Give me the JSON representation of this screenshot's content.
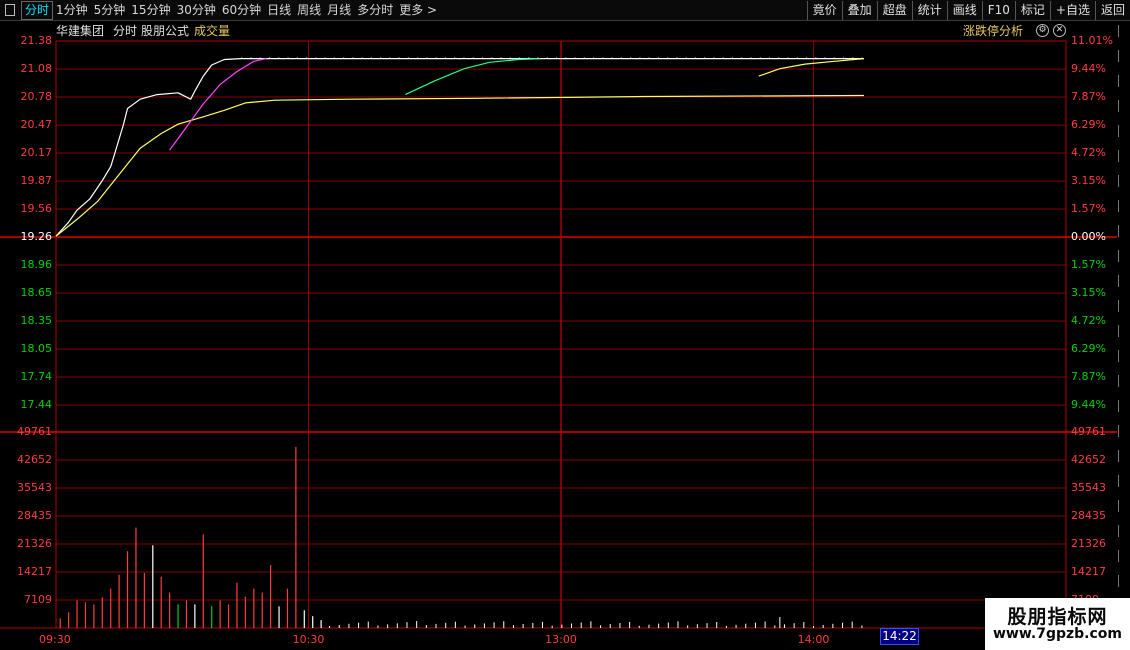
{
  "toolbar": {
    "tabs": [
      "分时",
      "1分钟",
      "5分钟",
      "15分钟",
      "30分钟",
      "60分钟",
      "日线",
      "周线",
      "月线",
      "多分时",
      "更多 >"
    ],
    "active_tab": "分时",
    "right_buttons": [
      "竟价",
      "叠加",
      "超盘",
      "统计",
      "画线",
      "F10",
      "标记",
      "+自选",
      "返回"
    ]
  },
  "header": {
    "stock_name": "华建集团",
    "mode": "分时",
    "formula": "股朋公式",
    "indicator": "成交量",
    "analysis_label": "涨跌停分析",
    "gear_icon": "gear-icon",
    "close_icon": "close-icon"
  },
  "price_axis": {
    "left_up": [
      "21.38",
      "21.08",
      "20.78",
      "20.47",
      "20.17",
      "19.87",
      "19.56"
    ],
    "base": "19.26",
    "left_down": [
      "18.96",
      "18.65",
      "18.35",
      "18.05",
      "17.74",
      "17.44"
    ],
    "right_up": [
      "11.01%",
      "9.44%",
      "7.87%",
      "6.29%",
      "4.72%",
      "3.15%",
      "1.57%"
    ],
    "base_pct": "0.00%",
    "right_down": [
      "1.57%",
      "3.15%",
      "4.72%",
      "6.29%",
      "7.87%",
      "9.44%"
    ]
  },
  "volume_axis": {
    "labels": [
      "49761",
      "42652",
      "35543",
      "28435",
      "21326",
      "14217",
      "7109"
    ]
  },
  "time_axis": {
    "labels": [
      "09:30",
      "10:30",
      "13:00",
      "14:00"
    ],
    "current_time": "14:22"
  },
  "watermark": {
    "title": "股朋指标网",
    "url": "www.7gpzb.com"
  },
  "colors": {
    "background": "#000000",
    "grid_red": "#b40000",
    "up_red": "#ff3c3c",
    "down_green": "#00d200",
    "price_line": "#ffffff",
    "avg_line": "#ffff60",
    "magenta_line": "#ff44ff",
    "green_line": "#20ff80",
    "header_yellow": "#e8c860",
    "accent_cyan": "#00e0ff"
  },
  "chart_data": {
    "type": "line",
    "base_price": 19.26,
    "price_ylim": [
      17.14,
      21.38
    ],
    "session_minutes": 240,
    "series": [
      {
        "values_by_minute": [
          [
            0,
            19.27
          ],
          [
            3,
            19.42
          ],
          [
            5,
            19.55
          ],
          [
            8,
            19.67
          ],
          [
            11,
            19.87
          ],
          [
            13,
            20.02
          ],
          [
            14,
            20.17
          ],
          [
            16,
            20.47
          ],
          [
            17,
            20.65
          ],
          [
            20,
            20.75
          ],
          [
            24,
            20.8
          ],
          [
            29,
            20.82
          ],
          [
            32,
            20.75
          ],
          [
            33,
            20.84
          ],
          [
            35,
            21.0
          ],
          [
            37,
            21.12
          ],
          [
            40,
            21.18
          ],
          [
            44,
            21.19
          ],
          [
            52,
            21.19
          ],
          [
            60,
            21.19
          ],
          [
            100,
            21.19
          ],
          [
            160,
            21.19
          ],
          [
            192,
            21.19
          ]
        ]
      },
      {
        "values_by_minute": [
          [
            0,
            19.27
          ],
          [
            5,
            19.45
          ],
          [
            10,
            19.65
          ],
          [
            14,
            19.88
          ],
          [
            17,
            20.05
          ],
          [
            20,
            20.22
          ],
          [
            25,
            20.38
          ],
          [
            29,
            20.48
          ],
          [
            35,
            20.56
          ],
          [
            40,
            20.63
          ],
          [
            45,
            20.71
          ],
          [
            52,
            20.74
          ],
          [
            70,
            20.75
          ],
          [
            100,
            20.76
          ],
          [
            140,
            20.78
          ],
          [
            192,
            20.79
          ]
        ]
      },
      {
        "values_by_minute": [
          [
            27,
            20.2
          ],
          [
            31,
            20.45
          ],
          [
            35,
            20.7
          ],
          [
            39,
            20.91
          ],
          [
            43,
            21.05
          ],
          [
            47,
            21.16
          ],
          [
            50,
            21.19
          ]
        ]
      },
      {
        "values_by_minute": [
          [
            83,
            20.8
          ],
          [
            90,
            20.95
          ],
          [
            97,
            21.08
          ],
          [
            103,
            21.15
          ],
          [
            110,
            21.18
          ],
          [
            115,
            21.19
          ]
        ]
      },
      {
        "values_by_minute": [
          [
            167,
            21.0
          ],
          [
            172,
            21.08
          ],
          [
            178,
            21.13
          ],
          [
            185,
            21.16
          ],
          [
            192,
            21.19
          ]
        ]
      }
    ],
    "volume_ylim": [
      0,
      49761
    ],
    "volume": [
      [
        1,
        2500,
        "up"
      ],
      [
        3,
        4000,
        "up"
      ],
      [
        5,
        7000,
        "up"
      ],
      [
        7,
        6500,
        "up"
      ],
      [
        9,
        6000,
        "up"
      ],
      [
        11,
        7800,
        "up"
      ],
      [
        13,
        10000,
        "up"
      ],
      [
        15,
        13500,
        "up"
      ],
      [
        17,
        19500,
        "up"
      ],
      [
        19,
        25500,
        "up"
      ],
      [
        21,
        14000,
        "up"
      ],
      [
        23,
        21000,
        "down_white"
      ],
      [
        25,
        13000,
        "up"
      ],
      [
        27,
        9000,
        "up"
      ],
      [
        29,
        6000,
        "green"
      ],
      [
        31,
        7000,
        "up"
      ],
      [
        33,
        6000,
        "down_white"
      ],
      [
        35,
        23800,
        "up"
      ],
      [
        37,
        5500,
        "green"
      ],
      [
        39,
        7000,
        "up"
      ],
      [
        41,
        6000,
        "up"
      ],
      [
        43,
        11500,
        "up"
      ],
      [
        45,
        8000,
        "up"
      ],
      [
        47,
        10000,
        "up"
      ],
      [
        49,
        9000,
        "up"
      ],
      [
        51,
        16000,
        "up"
      ],
      [
        53,
        5500,
        "down_white"
      ],
      [
        55,
        10000,
        "up"
      ],
      [
        57,
        46000,
        "up"
      ],
      [
        59,
        4500,
        "down_white"
      ],
      [
        61,
        3000,
        "down_white"
      ],
      [
        63,
        2000,
        "down_white"
      ]
    ]
  }
}
